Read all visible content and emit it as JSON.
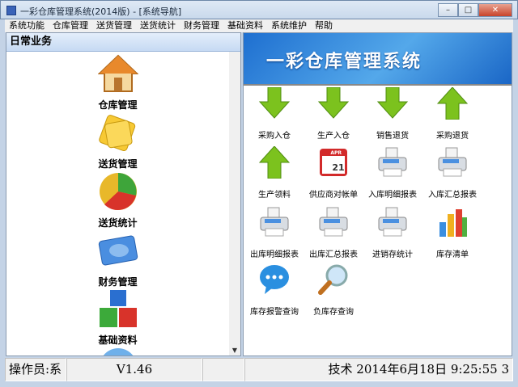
{
  "window": {
    "title": "一彩仓库管理系统(2014版) - [系统导航]",
    "min": "–",
    "max": "□",
    "close": "✕"
  },
  "menu": [
    "系统功能",
    "仓库管理",
    "送货管理",
    "送货统计",
    "财务管理",
    "基础资料",
    "系统维护",
    "帮助"
  ],
  "left": {
    "header": "日常业务",
    "items": [
      {
        "label": "仓库管理",
        "icon": "house-icon"
      },
      {
        "label": "送货管理",
        "icon": "folder-icon"
      },
      {
        "label": "送货统计",
        "icon": "pie-chart-icon"
      },
      {
        "label": "财务管理",
        "icon": "card-icon"
      },
      {
        "label": "基础资料",
        "icon": "blocks-icon"
      }
    ],
    "scroll_down": "▼"
  },
  "right": {
    "banner": "一彩仓库管理系统",
    "tiles": [
      {
        "label": "采购入仓",
        "icon": "arrow-down-icon"
      },
      {
        "label": "生产入仓",
        "icon": "arrow-down-icon"
      },
      {
        "label": "销售退货",
        "icon": "arrow-down-icon"
      },
      {
        "label": "采购退货",
        "icon": "arrow-up-icon"
      },
      {
        "label": "生产领料",
        "icon": "arrow-up-icon"
      },
      {
        "label": "供应商对帐单",
        "icon": "calendar-icon",
        "cal_month": "APR",
        "cal_day": "21"
      },
      {
        "label": "入库明细报表",
        "icon": "printer-icon"
      },
      {
        "label": "入库汇总报表",
        "icon": "printer-icon"
      },
      {
        "label": "出库明细报表",
        "icon": "printer-icon"
      },
      {
        "label": "出库汇总报表",
        "icon": "printer-icon"
      },
      {
        "label": "进销存统计",
        "icon": "printer-icon"
      },
      {
        "label": "库存清单",
        "icon": "bar-chart-icon"
      },
      {
        "label": "库存报警查询",
        "icon": "chat-icon"
      },
      {
        "label": "负库存查询",
        "icon": "magnifier-icon"
      }
    ]
  },
  "status": {
    "operator": "操作员:系",
    "version": "V1.46",
    "blank": "",
    "info": "技术  2014年6月18日  9:25:55  3"
  },
  "colors": {
    "green": "#7cc21e",
    "blue_banner": "#1e6fd0"
  }
}
